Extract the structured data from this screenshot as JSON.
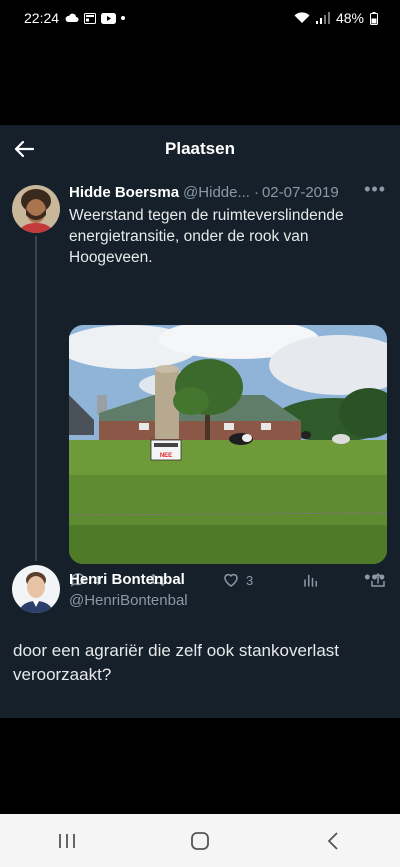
{
  "status_bar": {
    "time": "22:24",
    "battery": "48%"
  },
  "header": {
    "title": "Plaatsen"
  },
  "tweet": {
    "author_name": "Hidde Boersma",
    "handle": "@Hidde...",
    "separator": "·",
    "date": "02-07-2019",
    "text": "Weerstand tegen de ruimteverslindende energietransitie, onder de rook van Hoogeveen.",
    "image": {
      "sign_lines": [
        "NEE"
      ]
    },
    "actions": {
      "replies": "4",
      "retweets": "",
      "likes": "3"
    }
  },
  "reply": {
    "author_name": "Henri Bontenbal",
    "handle": "@HenriBontenbal",
    "text": "door een agrariër die zelf ook stankoverlast veroorzaakt?"
  },
  "colors": {
    "background": "#15202b",
    "secondary_text": "#8b98a5",
    "primary_text": "#e7e9ea"
  }
}
